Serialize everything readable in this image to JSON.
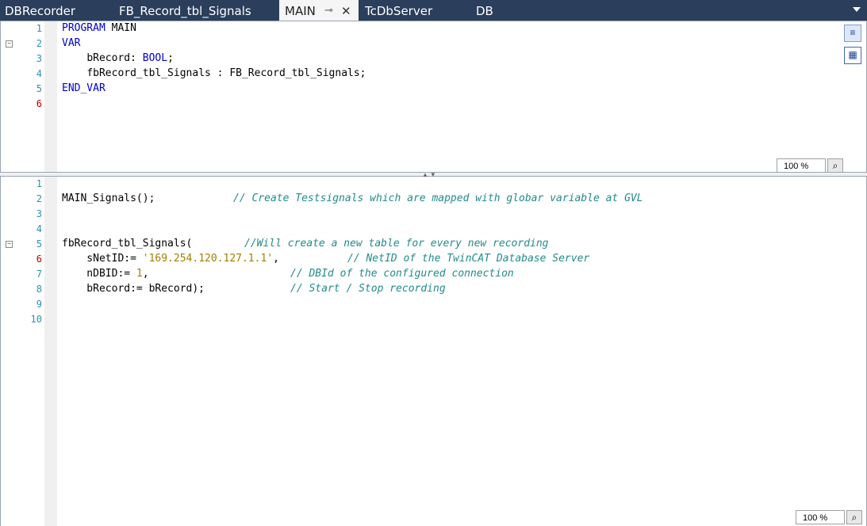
{
  "tabs": [
    {
      "label": "DBRecorder"
    },
    {
      "label": "FB_Record_tbl_Signals"
    },
    {
      "label": "MAIN",
      "active": true
    },
    {
      "label": "TcDbServer"
    },
    {
      "label": "DB"
    }
  ],
  "decl_pane": {
    "line_numbers": [
      "1",
      "2",
      "3",
      "4",
      "5",
      "6"
    ],
    "lines": [
      {
        "kw1": "PROGRAM",
        "rest": " MAIN"
      },
      {
        "kw1": "VAR",
        "rest": ""
      },
      {
        "indent": "    ",
        "name": "bRecord: ",
        "type": "BOOL",
        "end": ";"
      },
      {
        "indent": "    ",
        "name": "fbRecord_tbl_Signals : FB_Record_tbl_Signals;"
      },
      {
        "kw1": "END_VAR",
        "rest": ""
      }
    ],
    "zoom": "100 %"
  },
  "impl_pane": {
    "line_numbers": [
      "1",
      "2",
      "3",
      "4",
      "5",
      "6",
      "7",
      "8",
      "9",
      "10"
    ],
    "line2_code": "MAIN_Signals();",
    "line2_comment": "// Create Testsignals which are mapped with globar variable at GVL",
    "line5_code": "fbRecord_tbl_Signals(",
    "line5_comment": "//Will create a new table for every new recording",
    "line6_code": "    sNetID:= ",
    "line6_str": "'169.254.120.127.1.1'",
    "line6_end": ",",
    "line6_comment": "// NetID of the TwinCAT Database Server",
    "line7_code": "    nDBID:= ",
    "line7_num": "1",
    "line7_end": ",",
    "line7_comment": "// DBId of the configured connection",
    "line8_code": "    bRecord:= bRecord);",
    "line8_comment": "// Start / Stop recording",
    "zoom": "100 %"
  },
  "colors": {
    "tabbar": "#2b3e5c",
    "keyword": "#0000cc",
    "comment": "#228b8b",
    "literal": "#a08000",
    "line_number": "#2b91af"
  }
}
